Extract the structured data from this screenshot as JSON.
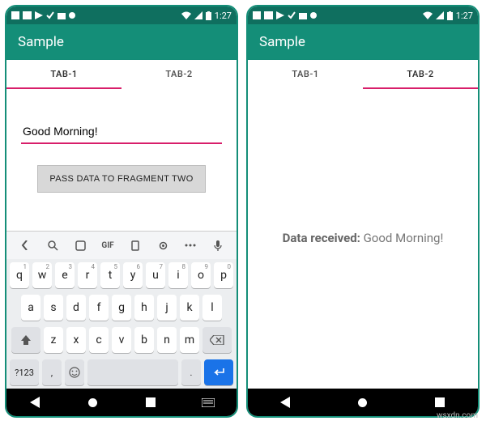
{
  "statusbar": {
    "time": "1:27",
    "battery_icon": "battery",
    "signal": [
      "wifi",
      "cell"
    ]
  },
  "appbar": {
    "title": "Sample"
  },
  "tabs": {
    "items": [
      {
        "label": "TAB-1"
      },
      {
        "label": "TAB-2"
      }
    ],
    "left_active": 0,
    "right_active": 1
  },
  "screen_left": {
    "input_value": "Good Morning!",
    "button_label": "PASS DATA TO FRAGMENT TWO"
  },
  "screen_right": {
    "received_prefix": "Data received: ",
    "received_value": "Good Morning!"
  },
  "keyboard": {
    "toolbar": [
      "chevron",
      "search",
      "sticker",
      "gif",
      "clipboard",
      "settings",
      "more",
      "mic"
    ],
    "gif_label": "GIF",
    "row1": [
      {
        "k": "q",
        "n": "1"
      },
      {
        "k": "w",
        "n": "2"
      },
      {
        "k": "e",
        "n": "3"
      },
      {
        "k": "r",
        "n": "4"
      },
      {
        "k": "t",
        "n": "5"
      },
      {
        "k": "y",
        "n": "6"
      },
      {
        "k": "u",
        "n": "7"
      },
      {
        "k": "i",
        "n": "8"
      },
      {
        "k": "o",
        "n": "9"
      },
      {
        "k": "p",
        "n": "0"
      }
    ],
    "row2": [
      "a",
      "s",
      "d",
      "f",
      "g",
      "h",
      "j",
      "k",
      "l"
    ],
    "row3": [
      "z",
      "x",
      "c",
      "v",
      "b",
      "n",
      "m"
    ],
    "fn_label": "?123",
    "comma": ",",
    "period": "."
  },
  "watermark": "wsxdn.com"
}
